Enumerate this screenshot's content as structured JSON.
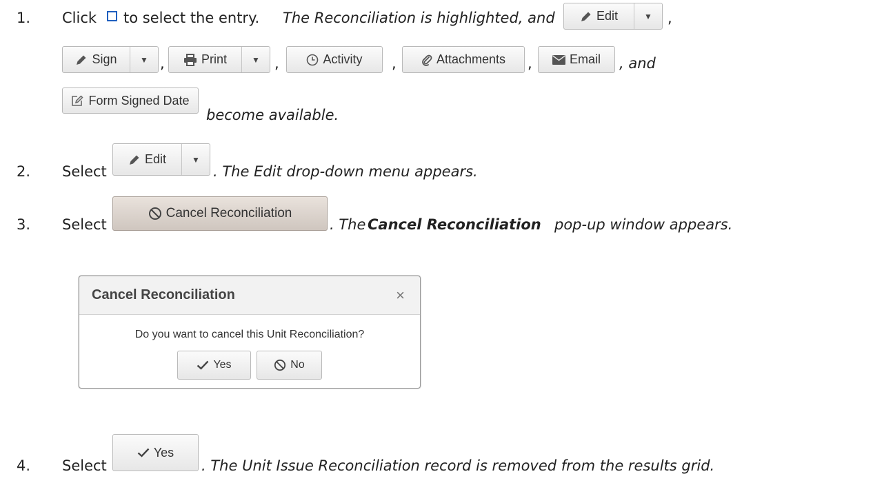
{
  "steps": [
    {
      "number": "1.",
      "click_text": "Click",
      "select_text": "to select the entry.",
      "italic_text": "The Reconciliation is highlighted, and",
      "comma": ",",
      "and_text": ", and",
      "become_text": "become available."
    },
    {
      "number": "2.",
      "select_text": "Select",
      "italic_text": ". The Edit drop-down menu appears."
    },
    {
      "number": "3.",
      "select_text": "Select",
      "italic_pre": ". The",
      "bold_italic": "Cancel Reconciliation",
      "italic_post": "pop-up window appears."
    },
    {
      "number": "4.",
      "select_text": "Select",
      "italic_text": ". The Unit Issue Reconciliation record is removed from the results grid."
    }
  ],
  "buttons": {
    "edit": "Edit",
    "sign": "Sign",
    "print": "Print",
    "activity": "Activity",
    "attachments": "Attachments",
    "email": "Email",
    "form_signed_date": "Form Signed Date",
    "cancel_reconciliation": "Cancel Reconciliation",
    "yes": "Yes"
  },
  "dialog": {
    "title": "Cancel Reconciliation",
    "close": "×",
    "message": "Do you want to cancel this Unit Reconciliation?",
    "yes": "Yes",
    "no": "No"
  },
  "icons": {
    "pencil": "pencil-icon",
    "printer": "printer-icon",
    "clock": "clock-icon",
    "paperclip": "paperclip-icon",
    "envelope": "envelope-icon",
    "edit_box": "edit-box-icon",
    "ban": "ban-icon",
    "check": "check-icon",
    "caret": "caret-down-icon",
    "checkbox": "checkbox-icon"
  },
  "colors": {
    "checkbox_border": "#1f5fbf",
    "cancel_button_bg": "#d9d0c9"
  }
}
